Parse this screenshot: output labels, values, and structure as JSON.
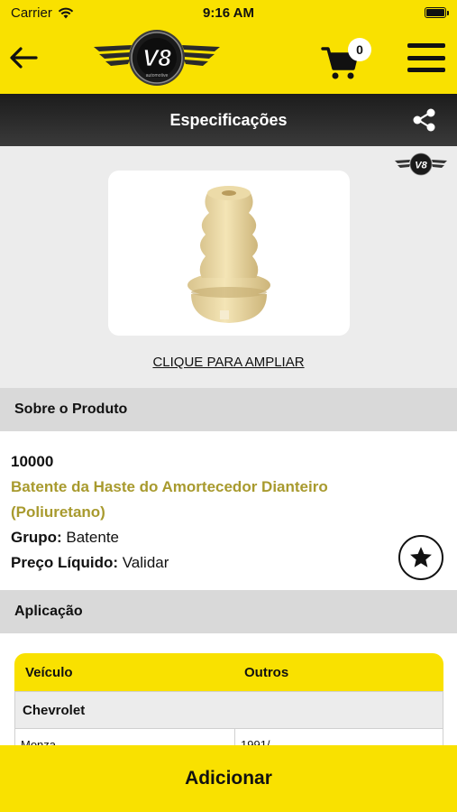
{
  "status_bar": {
    "carrier": "Carrier",
    "time": "9:16 AM",
    "wifi_icon": "wifi-icon",
    "battery_icon": "battery-icon"
  },
  "header": {
    "back_icon": "arrow-left-icon",
    "logo_text": "V8",
    "logo_subtext": "automotive",
    "cart_count": "0",
    "menu_icon": "hamburger-menu-icon",
    "background_color": "#f9e100"
  },
  "title_bar": {
    "title": "Especificações",
    "share_icon": "share-icon"
  },
  "product_image": {
    "zoom_label": "CLIQUE PARA AMPLIAR"
  },
  "about": {
    "section_title": "Sobre o Produto",
    "code": "10000",
    "name": "Batente da Haste do Amortecedor Dianteiro (Poliuretano)",
    "group_label": "Grupo:",
    "group_value": "Batente",
    "price_label": "Preço Líquido:",
    "price_value": "Validar",
    "favorite_icon": "star-icon",
    "name_color": "#a89a2e"
  },
  "application": {
    "section_title": "Aplicação",
    "columns": [
      "Veículo",
      "Outros"
    ],
    "make": "Chevrolet",
    "rows": [
      [
        "Monza",
        "1991/"
      ]
    ]
  },
  "footer": {
    "add_label": "Adicionar"
  }
}
